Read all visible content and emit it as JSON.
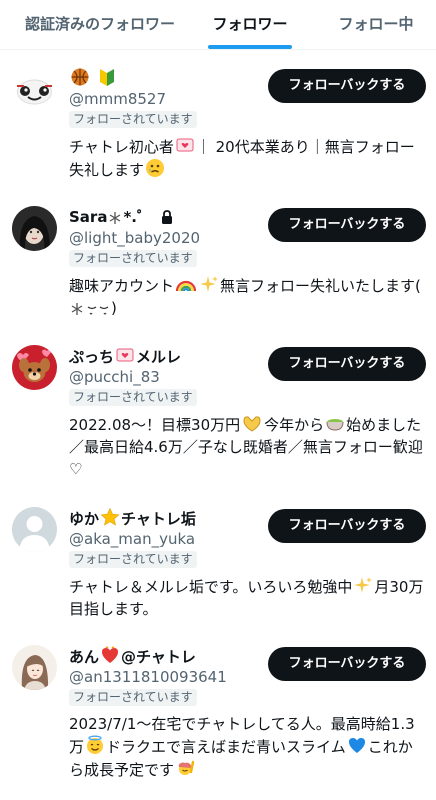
{
  "tabs": [
    {
      "label": "認証済みのフォロワー",
      "active": false
    },
    {
      "label": "フォロワー",
      "active": true
    },
    {
      "label": "フォロー中",
      "active": false
    }
  ],
  "follow_back_label": "フォローバックする",
  "follows_you_label": "フォローされています",
  "users": [
    {
      "name_after": "",
      "handle": "@mmm8527",
      "bio": [
        "チャトレ初心者",
        "｜ 20代本業あり｜無言フォロー失礼します"
      ]
    },
    {
      "name": "Sara",
      "name_after": "*.゜",
      "handle": "@light_baby2020",
      "bio": [
        "趣味アカウント",
        "無言フォロー失礼いたします(",
        ")"
      ]
    },
    {
      "name": "ぷっち",
      "name_after": "メルレ",
      "handle": "@pucchi_83",
      "bio": [
        "2022.08～！目標30万円",
        "今年から",
        "始めました／最高日給4.6万／子なし既婚者／無言フォロー歓迎♡"
      ]
    },
    {
      "name": "ゆか",
      "name_after": "チャトレ垢",
      "handle": "@aka_man_yuka",
      "bio": [
        "チャトレ＆メルレ垢です。いろいろ勉強中",
        "月30万目指します。"
      ]
    },
    {
      "name": "あん",
      "name_after": "@チャトレ",
      "handle": "@an1311810093641",
      "bio": [
        "2023/7/1～在宅でチャトレしてる人。最高時給1.3万",
        "ドラクエで言えばまだ青いスライム",
        "これから成長予定です"
      ]
    }
  ]
}
